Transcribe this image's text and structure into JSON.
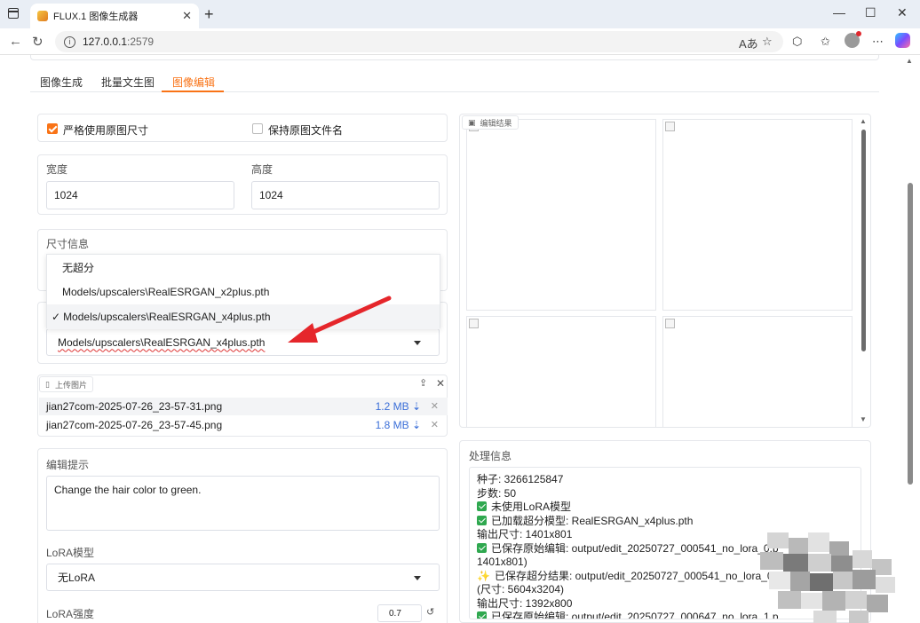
{
  "browser": {
    "tab_title": "FLUX.1 图像生成器",
    "url_host": "127.0.0.1",
    "url_port": ":2579"
  },
  "tabs": [
    "图像生成",
    "批量文生图",
    "图像编辑"
  ],
  "options": {
    "strict_size_label": "严格使用原图尺寸",
    "strict_size_checked": true,
    "keep_name_label": "保持原图文件名",
    "keep_name_checked": false
  },
  "size": {
    "width_label": "宽度",
    "width_value": "1024",
    "height_label": "高度",
    "height_value": "1024",
    "info_label": "尺寸信息"
  },
  "upscale": {
    "options": [
      "无超分",
      "Models/upscalers\\RealESRGAN_x2plus.pth",
      "Models/upscalers\\RealESRGAN_x4plus.pth"
    ],
    "selected_mark": "✓",
    "selected_value": "Models/upscalers\\RealESRGAN_x4plus.pth"
  },
  "upload": {
    "label": "上传图片",
    "files": [
      {
        "name": "jian27com-2025-07-26_23-57-31.png",
        "size": "1.2 MB ⇣"
      },
      {
        "name": "jian27com-2025-07-26_23-57-45.png",
        "size": "1.8 MB ⇣"
      }
    ]
  },
  "prompt": {
    "label": "编辑提示",
    "value": "Change the hair color to green."
  },
  "lora": {
    "model_label": "LoRA模型",
    "model_value": "无LoRA",
    "strength_label": "LoRA强度",
    "strength_value": "0.7"
  },
  "results": {
    "label": "编辑结果"
  },
  "process": {
    "label": "处理信息",
    "lines": [
      {
        "icon": "",
        "text": "种子: 3266125847"
      },
      {
        "icon": "",
        "text": "步数: 50"
      },
      {
        "icon": "ok",
        "text": "未使用LoRA模型"
      },
      {
        "icon": "ok",
        "text": "已加载超分模型: RealESRGAN_x4plus.pth"
      },
      {
        "icon": "",
        "text": "输出尺寸: 1401x801"
      },
      {
        "icon": "ok",
        "text": "已保存原始编辑: output/edit_20250727_000541_no_lora_0.p"
      },
      {
        "icon": "",
        "text": "1401x801)"
      },
      {
        "icon": "spark",
        "text": "已保存超分结果: output/edit_20250727_000541_no_lora_0_u"
      },
      {
        "icon": "",
        "text": "(尺寸: 5604x3204)"
      },
      {
        "icon": "",
        "text": "输出尺寸: 1392x800"
      },
      {
        "icon": "ok",
        "text": "已保存原始编辑: output/edit_20250727_000647_no_lora_1.p"
      }
    ]
  },
  "colors": {
    "accent": "#f97316",
    "annotation_arrow": "#e5262b"
  }
}
